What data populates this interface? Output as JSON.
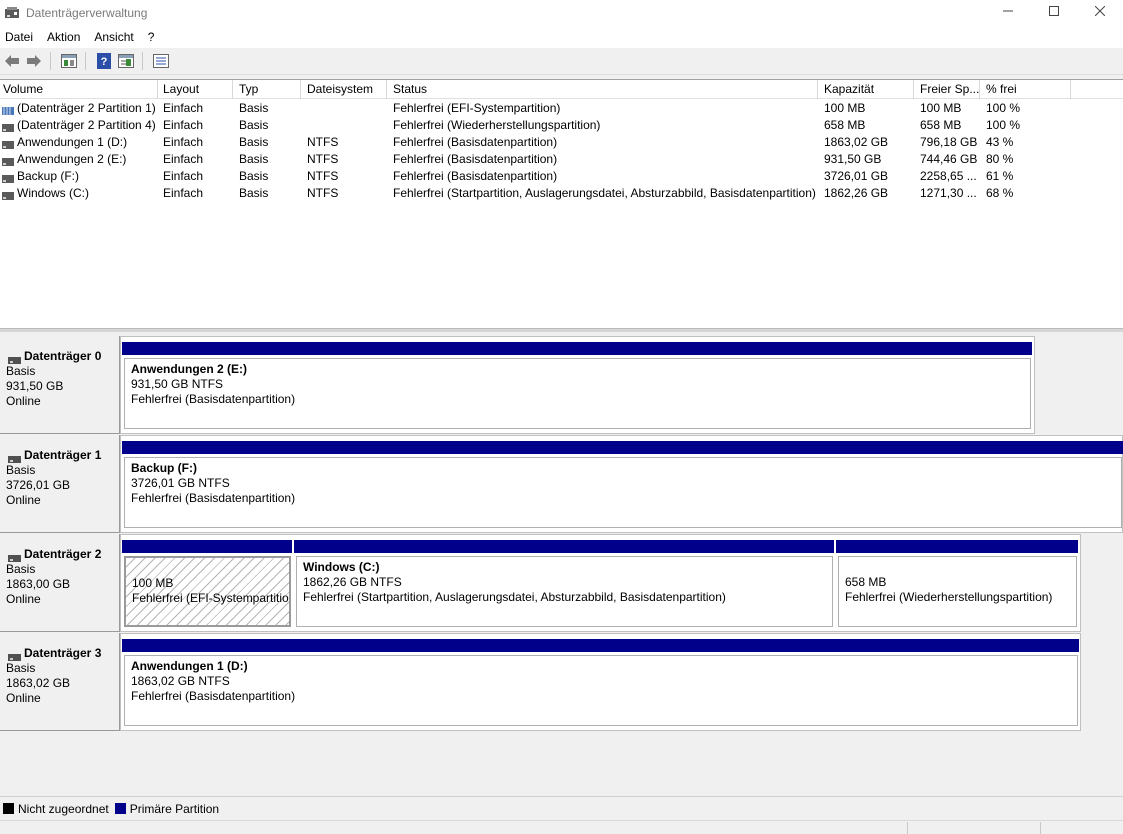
{
  "window": {
    "title": "Datenträgerverwaltung",
    "icon": "disk-management-icon",
    "controls": [
      "minimize-icon",
      "maximize-icon",
      "close-icon"
    ]
  },
  "menu": [
    "Datei",
    "Aktion",
    "Ansicht",
    "?"
  ],
  "toolbar": {
    "buttons": [
      "back-arrow-icon",
      "forward-arrow-icon",
      "properties-icon",
      "help-icon",
      "console-tree-icon",
      "list-view-icon"
    ]
  },
  "columns": [
    "Volume",
    "Layout",
    "Typ",
    "Dateisystem",
    "Status",
    "Kapazität",
    "Freier Sp...",
    "% frei"
  ],
  "volumes": [
    {
      "volume": "(Datenträger 2 Partition 1)",
      "layout": "Einfach",
      "type": "Basis",
      "fs": "",
      "status": "Fehlerfrei (EFI-Systempartition)",
      "capacity": "100 MB",
      "free": "100 MB",
      "pct": "100 %",
      "icon": "striped-volume-icon"
    },
    {
      "volume": "(Datenträger 2 Partition 4)",
      "layout": "Einfach",
      "type": "Basis",
      "fs": "",
      "status": "Fehlerfrei (Wiederherstellungspartition)",
      "capacity": "658 MB",
      "free": "658 MB",
      "pct": "100 %",
      "icon": "volume-icon"
    },
    {
      "volume": "Anwendungen 1 (D:)",
      "layout": "Einfach",
      "type": "Basis",
      "fs": "NTFS",
      "status": "Fehlerfrei (Basisdatenpartition)",
      "capacity": "1863,02 GB",
      "free": "796,18 GB",
      "pct": "43 %",
      "icon": "volume-icon"
    },
    {
      "volume": "Anwendungen 2 (E:)",
      "layout": "Einfach",
      "type": "Basis",
      "fs": "NTFS",
      "status": "Fehlerfrei (Basisdatenpartition)",
      "capacity": "931,50 GB",
      "free": "744,46 GB",
      "pct": "80 %",
      "icon": "volume-icon"
    },
    {
      "volume": "Backup (F:)",
      "layout": "Einfach",
      "type": "Basis",
      "fs": "NTFS",
      "status": "Fehlerfrei (Basisdatenpartition)",
      "capacity": "3726,01 GB",
      "free": "2258,65 ...",
      "pct": "61 %",
      "icon": "volume-icon"
    },
    {
      "volume": "Windows (C:)",
      "layout": "Einfach",
      "type": "Basis",
      "fs": "NTFS",
      "status": "Fehlerfrei (Startpartition, Auslagerungsdatei, Absturzabbild, Basisdatenpartition)",
      "capacity": "1862,26 GB",
      "free": "1271,30 ...",
      "pct": "68 %",
      "icon": "volume-icon"
    }
  ],
  "disks": [
    {
      "name": "Datenträger 0",
      "type": "Basis",
      "size": "931,50 GB",
      "state": "Online",
      "partitions": [
        {
          "name": "Anwendungen 2  (E:)",
          "size": "931,50 GB NTFS",
          "status": "Fehlerfrei (Basisdatenpartition)"
        }
      ]
    },
    {
      "name": "Datenträger 1",
      "type": "Basis",
      "size": "3726,01 GB",
      "state": "Online",
      "partitions": [
        {
          "name": "Backup  (F:)",
          "size": "3726,01 GB NTFS",
          "status": "Fehlerfrei (Basisdatenpartition)"
        }
      ]
    },
    {
      "name": "Datenträger 2",
      "type": "Basis",
      "size": "1863,00 GB",
      "state": "Online",
      "partitions": [
        {
          "name": "",
          "size": "100 MB",
          "status": "Fehlerfrei (EFI-Systempartition)",
          "selected": true
        },
        {
          "name": "Windows  (C:)",
          "size": "1862,26 GB NTFS",
          "status": "Fehlerfrei (Startpartition, Auslagerungsdatei, Absturzabbild, Basisdatenpartition)"
        },
        {
          "name": "",
          "size": "658 MB",
          "status": "Fehlerfrei (Wiederherstellungspartition)"
        }
      ]
    },
    {
      "name": "Datenträger 3",
      "type": "Basis",
      "size": "1863,02 GB",
      "state": "Online",
      "partitions": [
        {
          "name": "Anwendungen 1  (D:)",
          "size": "1863,02 GB NTFS",
          "status": "Fehlerfrei (Basisdatenpartition)"
        }
      ]
    }
  ],
  "legend": [
    {
      "label": "Nicht zugeordnet",
      "color": "#000000"
    },
    {
      "label": "Primäre Partition",
      "color": "#00008b"
    }
  ],
  "colors": {
    "primary_partition": "#00008b",
    "unallocated": "#000000"
  }
}
